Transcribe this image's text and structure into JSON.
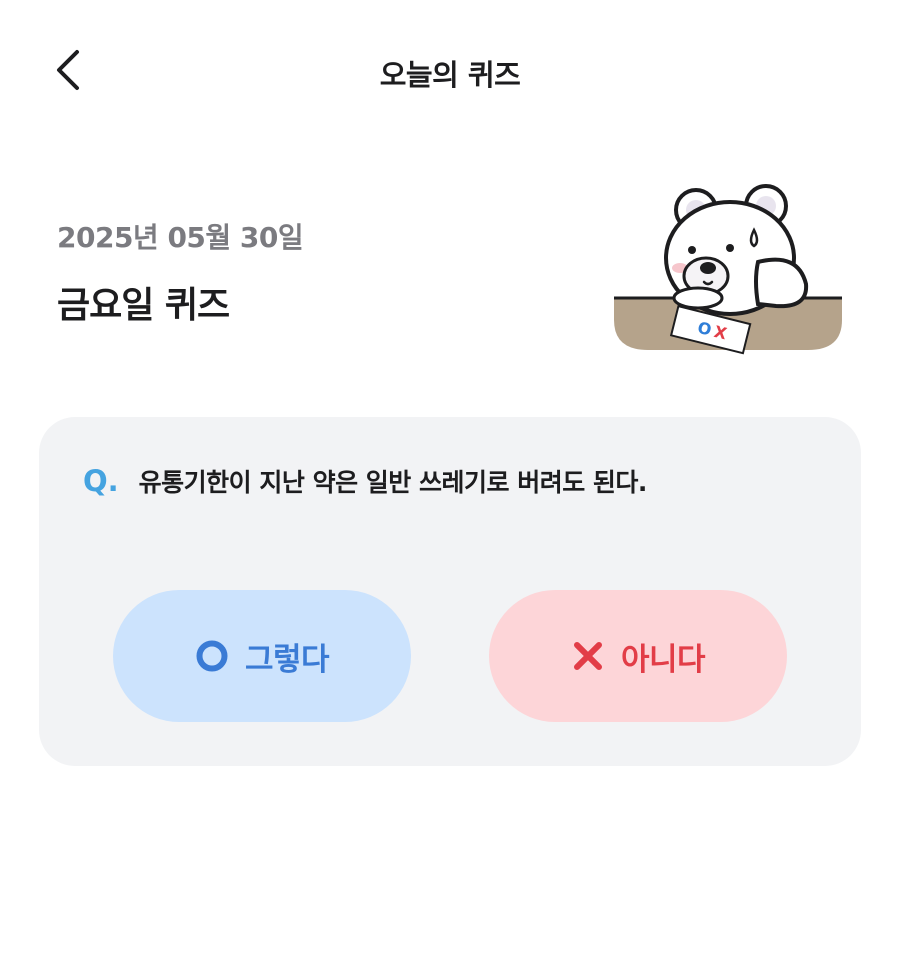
{
  "header": {
    "title": "오늘의 퀴즈",
    "back_icon": "chevron-left-icon"
  },
  "intro": {
    "date": "2025년 05월 30일",
    "title": "금요일 퀴즈",
    "mascot_ox_letters": "OX"
  },
  "question": {
    "prefix": "Q.",
    "text": "유통기한이 지난 약은 일반 쓰레기로 버려도 된다."
  },
  "answers": [
    {
      "label": "그렇다",
      "icon": "circle-o-icon",
      "color": "#3a7bd5",
      "background": "#cce3fd"
    },
    {
      "label": "아니다",
      "icon": "x-mark-icon",
      "color": "#e23d47",
      "background": "#fdd5d8"
    }
  ],
  "colors": {
    "accent": "#45a3e0",
    "card_background": "#f2f3f5",
    "text_primary": "#1d1d1f",
    "text_secondary": "#7b7b80"
  }
}
